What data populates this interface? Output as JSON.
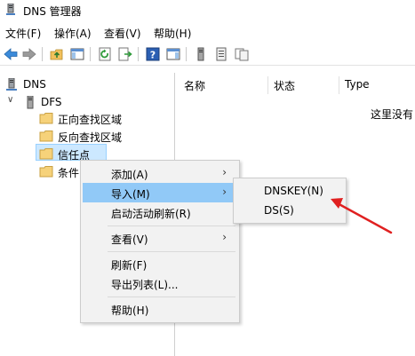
{
  "window": {
    "title": "DNS 管理器"
  },
  "menubar": {
    "items": [
      "文件(F)",
      "操作(A)",
      "查看(V)",
      "帮助(H)"
    ]
  },
  "toolbar": {
    "icons": [
      "back-arrow-icon",
      "forward-arrow-icon",
      "up-folder-icon",
      "show-hide-console-tree-icon",
      "refresh-icon",
      "export-list-icon",
      "help-icon",
      "show-hide-action-pane-icon",
      "server-icon",
      "properties-list-icon",
      "copy-icon"
    ]
  },
  "tree": {
    "root": "DNS",
    "server": "DFS",
    "items": [
      "正向查找区域",
      "反向查找区域",
      "信任点",
      "条件"
    ],
    "selected": "信任点"
  },
  "list": {
    "columns": [
      "名称",
      "状态",
      "Type"
    ],
    "empty_text": "这里没有"
  },
  "context_menu": {
    "items": [
      {
        "label": "添加(A)",
        "submenu": true
      },
      {
        "label": "导入(M)",
        "submenu": true,
        "highlighted": true
      },
      {
        "label": "启动活动刷新(R)",
        "submenu": false
      },
      {
        "label": "查看(V)",
        "submenu": true
      },
      {
        "label": "刷新(F)",
        "submenu": false
      },
      {
        "label": "导出列表(L)...",
        "submenu": false
      },
      {
        "label": "帮助(H)",
        "submenu": false
      }
    ],
    "submenu_arrow": "›"
  },
  "import_submenu": {
    "items": [
      "DNSKEY(N)",
      "DS(S)"
    ],
    "highlighted": "DNSKEY(N)"
  },
  "colors": {
    "selection": "#cce8ff",
    "menu_highlight": "#91c9f7",
    "annotation_arrow": "#e02020"
  }
}
